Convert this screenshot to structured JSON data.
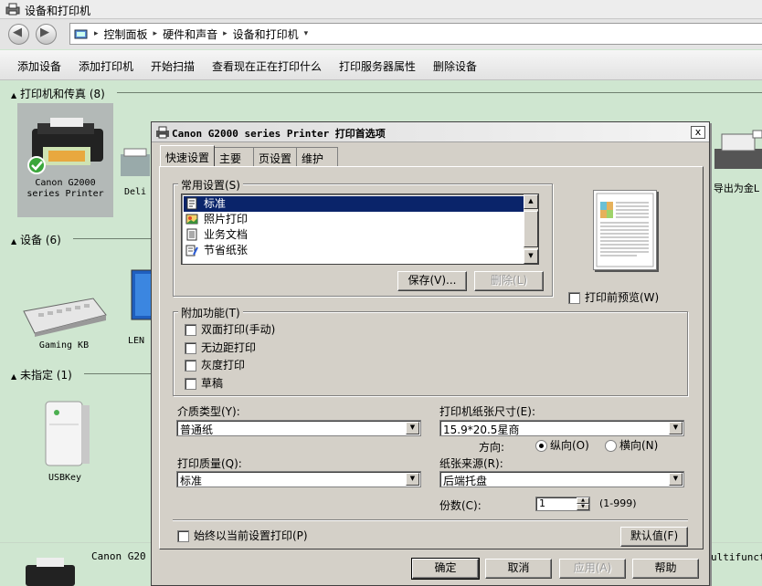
{
  "window": {
    "title": "设备和打印机"
  },
  "address": {
    "crumbs": [
      "控制面板",
      "硬件和声音",
      "设备和打印机"
    ]
  },
  "toolbar": {
    "items": [
      "添加设备",
      "添加打印机",
      "开始扫描",
      "查看现在正在打印什么",
      "打印服务器属性",
      "删除设备"
    ]
  },
  "sections": {
    "printers": {
      "title": "打印机和传真",
      "count": "(8)"
    },
    "devices": {
      "title": "设备",
      "count": "(6)"
    },
    "unspecified": {
      "title": "未指定",
      "count": "(1)"
    }
  },
  "devices": {
    "canon": "Canon G2000\nseries Printer",
    "deli": "Deli",
    "export": "导出为金L",
    "keyboard": "Gaming KB",
    "monitor": "LEN",
    "usbkey": "USBKey",
    "bottom_canon": "Canon G20",
    "bottom_right": "ultifuncti"
  },
  "dialog": {
    "title": "Canon G2000 series Printer 打印首选项",
    "close": "x",
    "tabs": [
      "快速设置",
      "主要",
      "页设置",
      "维护"
    ],
    "common_settings": {
      "label": "常用设置(S)",
      "items": [
        "标准",
        "照片打印",
        "业务文档",
        "节省纸张"
      ],
      "selected": "标准",
      "save_button": "保存(V)...",
      "delete_button": "删除(L)"
    },
    "preview_checkbox": "打印前预览(W)",
    "additional": {
      "label": "附加功能(T)",
      "options": [
        "双面打印(手动)",
        "无边距打印",
        "灰度打印",
        "草稿"
      ]
    },
    "media_type": {
      "label": "介质类型(Y):",
      "value": "普通纸"
    },
    "paper_size": {
      "label": "打印机纸张尺寸(E):",
      "value": "15.9*20.5星商"
    },
    "orientation": {
      "label": "方向:",
      "portrait": "纵向(O)",
      "landscape": "横向(N)",
      "selected": "portrait"
    },
    "print_quality": {
      "label": "打印质量(Q):",
      "value": "标准"
    },
    "paper_source": {
      "label": "纸张来源(R):",
      "value": "后端托盘"
    },
    "copies": {
      "label": "份数(C):",
      "value": "1",
      "range": "(1-999)"
    },
    "always_print": "始终以当前设置打印(P)",
    "defaults_button": "默认值(F)",
    "ok_button": "确定",
    "cancel_button": "取消",
    "apply_button": "应用(A)",
    "help_button": "帮助"
  }
}
